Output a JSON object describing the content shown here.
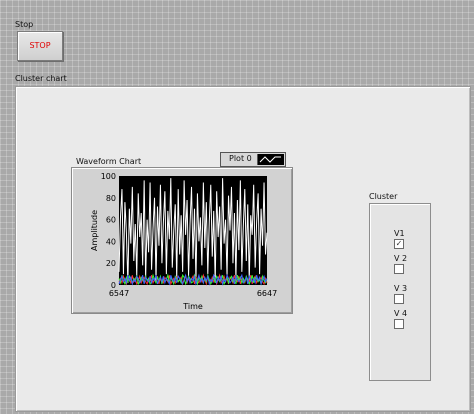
{
  "stop": {
    "label": "Stop",
    "button_text": "STOP"
  },
  "cluster_chart": {
    "label": "Cluster chart",
    "waveform": {
      "title": "Waveform Chart",
      "legend_label": "Plot 0",
      "colors": {
        "background": "#000000",
        "v1": "#ffffff",
        "others": [
          "#ff3030",
          "#30ff30",
          "#4060ff"
        ]
      }
    }
  },
  "cluster": {
    "label": "Cluster",
    "items": [
      {
        "label": "V1",
        "checked": true
      },
      {
        "label": "V 2",
        "checked": false
      },
      {
        "label": "V 3",
        "checked": false
      },
      {
        "label": "V 4",
        "checked": false
      }
    ]
  },
  "chart_data": {
    "type": "line",
    "title": "",
    "xlabel": "Time",
    "ylabel": "Amplitude",
    "xlim": [
      6547,
      6647
    ],
    "ylim": [
      0,
      100
    ],
    "x_ticks": [
      6547,
      6647
    ],
    "y_ticks": [
      0,
      20,
      40,
      60,
      80,
      100
    ],
    "grid": false,
    "series": [
      {
        "values": [
          12,
          62,
          88,
          10,
          76,
          48,
          2,
          70,
          38,
          90,
          22,
          56,
          8,
          84,
          44,
          66,
          18,
          96,
          6,
          60,
          30,
          94,
          14,
          52,
          80,
          4,
          72,
          36,
          92,
          20,
          58,
          86,
          10,
          68,
          42,
          98,
          16,
          50,
          74,
          6,
          88,
          28,
          64,
          12,
          96,
          46,
          78,
          8,
          56,
          90,
          24,
          70,
          4,
          84,
          40,
          62,
          18,
          94,
          34,
          76,
          10,
          58,
          92,
          26,
          68,
          2,
          86,
          44,
          72,
          14,
          98,
          38,
          60,
          8,
          82,
          50,
          90,
          20,
          66,
          6,
          78,
          32,
          96,
          12,
          54,
          88,
          22,
          74,
          4,
          64,
          46,
          92,
          16,
          58,
          84,
          10,
          70,
          36,
          94,
          28,
          48
        ]
      },
      {
        "values": [
          3,
          6,
          2,
          8,
          4,
          1,
          7,
          5,
          2,
          9,
          3,
          6,
          1,
          4,
          8,
          2,
          5,
          7,
          3,
          1,
          6,
          4,
          9,
          2,
          5,
          3,
          8,
          1,
          6,
          4,
          2,
          7,
          5,
          3,
          9,
          1,
          4,
          6,
          2,
          8,
          3,
          5,
          7,
          1,
          4,
          9,
          2,
          6,
          3,
          5,
          8,
          1,
          7,
          4,
          2,
          6,
          3,
          9,
          5,
          1,
          8,
          4,
          2,
          7,
          3,
          6,
          1,
          5,
          9,
          2,
          4,
          8,
          3,
          6,
          1,
          7,
          5,
          2,
          9,
          4,
          3,
          8,
          1,
          6,
          5,
          2,
          7,
          4,
          3,
          9,
          1,
          6,
          8,
          2,
          5,
          4,
          7,
          3,
          1,
          6,
          2
        ]
      },
      {
        "values": [
          6,
          2,
          9,
          4,
          1,
          7,
          3,
          8,
          5,
          2,
          6,
          4,
          9,
          1,
          3,
          7,
          5,
          2,
          8,
          4,
          6,
          1,
          3,
          9,
          5,
          2,
          7,
          4,
          8,
          1,
          6,
          3,
          5,
          9,
          2,
          7,
          4,
          1,
          8,
          6,
          3,
          5,
          2,
          9,
          7,
          1,
          4,
          8,
          6,
          2,
          3,
          9,
          5,
          1,
          7,
          4,
          8,
          2,
          6,
          3,
          9,
          5,
          1,
          4,
          7,
          2,
          8,
          6,
          3,
          5,
          9,
          1,
          4,
          7,
          2,
          6,
          8,
          3,
          5,
          1,
          9,
          4,
          7,
          2,
          6,
          3,
          8,
          5,
          1,
          4,
          9,
          2,
          7,
          6,
          3,
          5,
          1,
          8,
          4,
          2,
          6
        ]
      },
      {
        "values": [
          1,
          5,
          8,
          3,
          6,
          2,
          9,
          4,
          7,
          1,
          5,
          3,
          8,
          6,
          2,
          4,
          9,
          1,
          7,
          5,
          3,
          8,
          2,
          6,
          4,
          9,
          1,
          5,
          7,
          3,
          8,
          2,
          6,
          4,
          1,
          9,
          5,
          3,
          7,
          2,
          8,
          6,
          4,
          1,
          5,
          9,
          3,
          7,
          2,
          6,
          4,
          8,
          1,
          5,
          9,
          3,
          6,
          2,
          7,
          4,
          8,
          1,
          5,
          3,
          9,
          6,
          2,
          7,
          4,
          8,
          1,
          5,
          3,
          9,
          6,
          2,
          4,
          7,
          1,
          8,
          5,
          3,
          6,
          9,
          2,
          4,
          7,
          1,
          8,
          5,
          3,
          6,
          2,
          9,
          4,
          7,
          1,
          5,
          8,
          3,
          6
        ]
      }
    ]
  }
}
